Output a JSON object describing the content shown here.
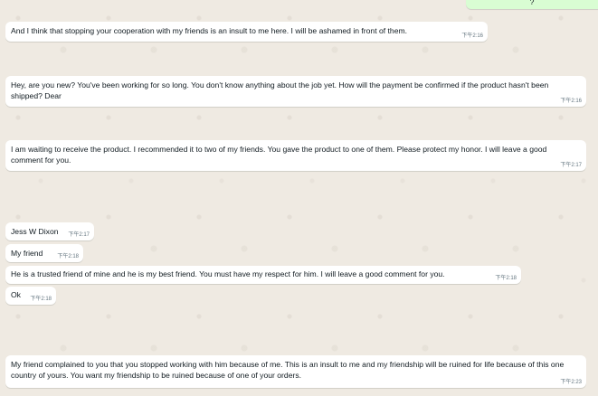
{
  "chat": {
    "messages": [
      {
        "id": "m0",
        "direction": "out",
        "text": "?",
        "time": ""
      },
      {
        "id": "m1",
        "direction": "in",
        "text": "And I think that stopping your cooperation with my friends is an insult to me here. I will be ashamed in front of them.",
        "time": "下午2:16"
      },
      {
        "id": "m2",
        "direction": "in",
        "text": "Hey, are you new? You've been working for so long. You don't know anything about the job yet. How will the payment be confirmed if the product hasn't been shipped? Dear",
        "time": "下午2:16"
      },
      {
        "id": "m3",
        "direction": "in",
        "text": "I am waiting to receive the product. I recommended it to two of my friends. You gave the product to one of them. Please protect my honor. I will leave a good comment for you.",
        "time": "下午2:17"
      },
      {
        "id": "m4",
        "direction": "in",
        "text": "Jess W Dixon",
        "time": "下午2:17"
      },
      {
        "id": "m5",
        "direction": "in",
        "text": "My friend",
        "time": "下午2:18"
      },
      {
        "id": "m6",
        "direction": "in",
        "text": "He is a trusted friend of mine and he is my best friend. You must have my respect for him. I will leave a good comment for you.",
        "time": "下午2:18"
      },
      {
        "id": "m7",
        "direction": "in",
        "text": "Ok",
        "time": "下午2:18"
      },
      {
        "id": "m8",
        "direction": "in",
        "text": "My friend complained to you that you stopped working with him because of me. This is an insult to me and my friendship will be ruined for life because of this one country of yours. You want my friendship to be ruined because of one of your orders.",
        "time": "下午2:23"
      }
    ]
  }
}
